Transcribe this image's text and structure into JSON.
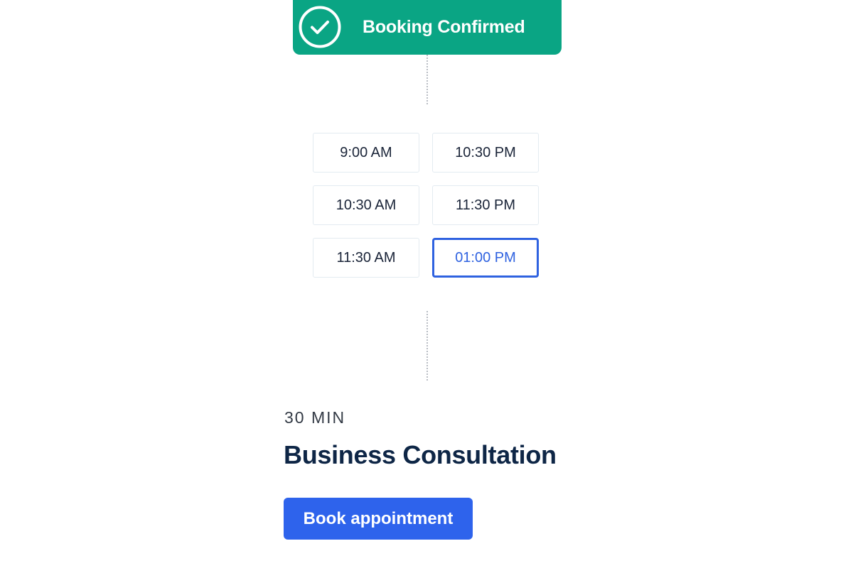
{
  "banner": {
    "text": "Booking Confirmed",
    "icon": "check-circle-icon",
    "color": "#0aa584"
  },
  "slots": [
    {
      "label": "9:00 AM",
      "selected": false
    },
    {
      "label": "10:30 PM",
      "selected": false
    },
    {
      "label": "10:30 AM",
      "selected": false
    },
    {
      "label": "11:30 PM",
      "selected": false
    },
    {
      "label": "11:30 AM",
      "selected": false
    },
    {
      "label": "01:00 PM",
      "selected": true
    }
  ],
  "details": {
    "duration": "30 MIN",
    "title": "Business Consultation",
    "button_label": "Book appointment"
  },
  "colors": {
    "accent": "#2e63ec",
    "selected_slot": "#2f62e0",
    "title": "#0e2646"
  }
}
